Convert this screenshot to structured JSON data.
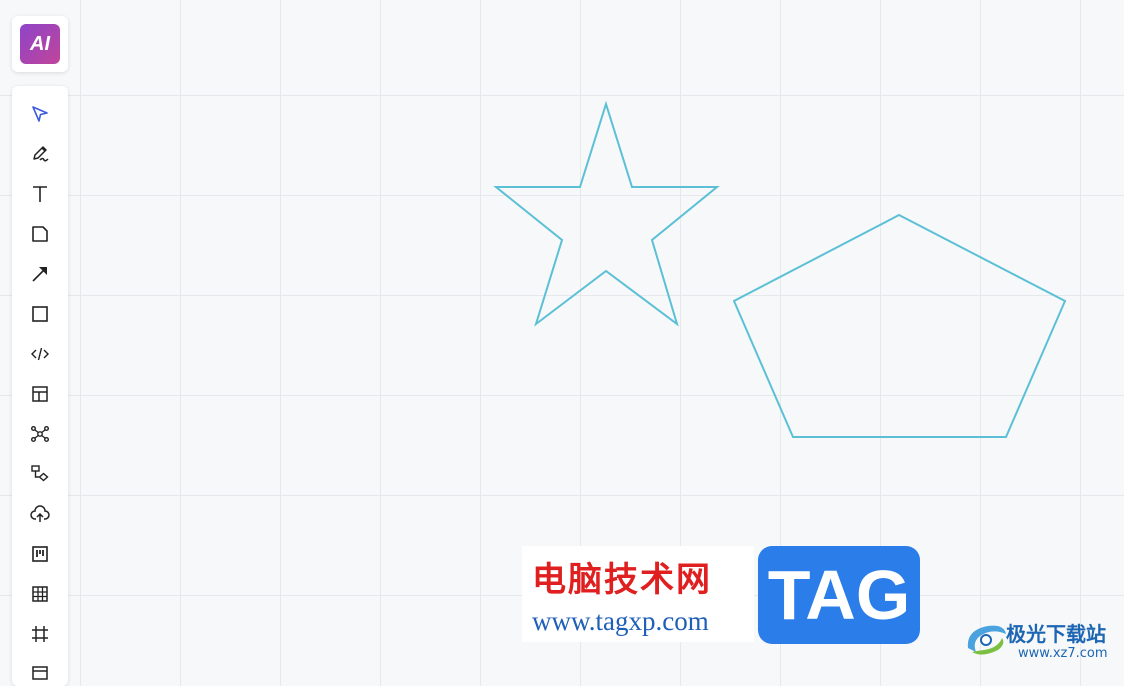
{
  "ai_button": {
    "label": "AI"
  },
  "toolbar": {
    "tools": [
      {
        "name": "select",
        "icon": "pointer-icon"
      },
      {
        "name": "pen",
        "icon": "pen-icon"
      },
      {
        "name": "text",
        "icon": "text-icon"
      },
      {
        "name": "sticky-note",
        "icon": "sticky-note-icon"
      },
      {
        "name": "arrow",
        "icon": "arrow-icon"
      },
      {
        "name": "rectangle",
        "icon": "rectangle-icon"
      },
      {
        "name": "code",
        "icon": "code-icon"
      },
      {
        "name": "layout",
        "icon": "layout-icon"
      },
      {
        "name": "mind-map",
        "icon": "mind-map-icon"
      },
      {
        "name": "flowchart",
        "icon": "flowchart-icon"
      },
      {
        "name": "upload",
        "icon": "cloud-upload-icon"
      },
      {
        "name": "kanban",
        "icon": "kanban-icon"
      },
      {
        "name": "table",
        "icon": "table-icon"
      },
      {
        "name": "frame",
        "icon": "frame-icon"
      },
      {
        "name": "more",
        "icon": "more-icon"
      }
    ]
  },
  "canvas": {
    "shapes": [
      {
        "type": "star",
        "stroke": "#5bc0d6"
      },
      {
        "type": "pentagon",
        "stroke": "#5bc0d6"
      }
    ]
  },
  "watermark": {
    "title_cn": "电脑技术网",
    "url": "www.tagxp.com",
    "tag": "TAG"
  },
  "corner_logo": {
    "title_cn": "极光下载站",
    "url": "www.xz7.com"
  },
  "colors": {
    "shape_stroke": "#5bc0d6",
    "select_tool_active": "#3b5bdb",
    "tag_bg": "#2b7de9",
    "watermark_red": "#e02020"
  }
}
